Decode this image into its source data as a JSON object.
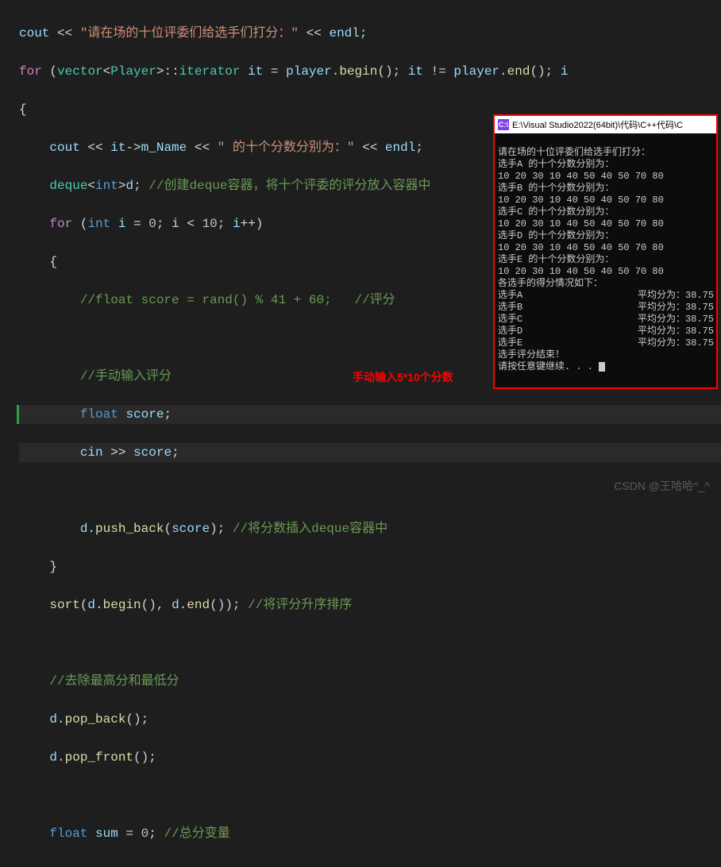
{
  "code": {
    "l1_str": "\"请在场的十位评委们给选手们打分：\"",
    "l1_cout": "cout",
    "l1_op": "<<",
    "l1_endl": "endl",
    "l2_for": "for",
    "l2_vector": "vector",
    "l2_player": "Player",
    "l2_iterator": "iterator",
    "l2_it": "it",
    "l2_player_var": "player",
    "l2_begin": "begin",
    "l2_end": "end",
    "l4_it": "it",
    "l4_mname": "m_Name",
    "l4_str": "\" 的十个分数分别为：\"",
    "l4_endl": "endl",
    "l5_deque": "deque",
    "l5_int": "int",
    "l5_d": "d",
    "l5_cmt": "//创建deque容器，将十个评委的评分放入容器中",
    "l6_for": "for",
    "l6_int": "int",
    "l6_i": "i",
    "l6_zero": "0",
    "l6_ten": "10",
    "l8_cmt": "//float score = rand() % 41 + 60;   //评分",
    "l10_cmt": "//手动输入评分",
    "l11_float": "float",
    "l11_score": "score",
    "l12_cin": "cin",
    "l12_score": "score",
    "l14_d": "d",
    "l14_push": "push_back",
    "l14_score": "score",
    "l14_cmt": "//将分数插入deque容器中",
    "l16_sort": "sort",
    "l16_d": "d",
    "l16_begin": "begin",
    "l16_end": "end",
    "l16_cmt": "//将评分升序排序",
    "l18_cmt": "//去除最高分和最低分",
    "l19_d": "d",
    "l19_popback": "pop_back",
    "l20_d": "d",
    "l20_popfront": "pop_front",
    "l22_float": "float",
    "l22_sum": "sum",
    "l22_zero": "0",
    "l22_cmt": "//总分变量"
  },
  "annotation": {
    "manual_input": "手动输入5*10个分数"
  },
  "console": {
    "title": "E:\\Visual Studio2022(64bit)\\代码\\C++代码\\C",
    "header": "请在场的十位评委们给选手们打分：",
    "players": [
      {
        "label": "选手A 的十个分数分别为：",
        "scores": "10 20 30 10 40 50 40 50 70 80"
      },
      {
        "label": "选手B 的十个分数分别为：",
        "scores": "10 20 30 10 40 50 40 50 70 80"
      },
      {
        "label": "选手C 的十个分数分别为：",
        "scores": "10 20 30 10 40 50 40 50 70 80"
      },
      {
        "label": "选手D 的十个分数分别为：",
        "scores": "10 20 30 10 40 50 40 50 70 80"
      },
      {
        "label": "选手E 的十个分数分别为：",
        "scores": "10 20 30 10 40 50 40 50 70 80"
      }
    ],
    "results_header": "各选手的得分情况如下：",
    "results": [
      {
        "name": "选手A",
        "avg": "平均分为：38.75"
      },
      {
        "name": "选手B",
        "avg": "平均分为：38.75"
      },
      {
        "name": "选手C",
        "avg": "平均分为：38.75"
      },
      {
        "name": "选手D",
        "avg": "平均分为：38.75"
      },
      {
        "name": "选手E",
        "avg": "平均分为：38.75"
      }
    ],
    "end": "选手评分结束！",
    "continue": "请按任意键继续. . . "
  },
  "watermark": "CSDN @王哈哈^_^"
}
